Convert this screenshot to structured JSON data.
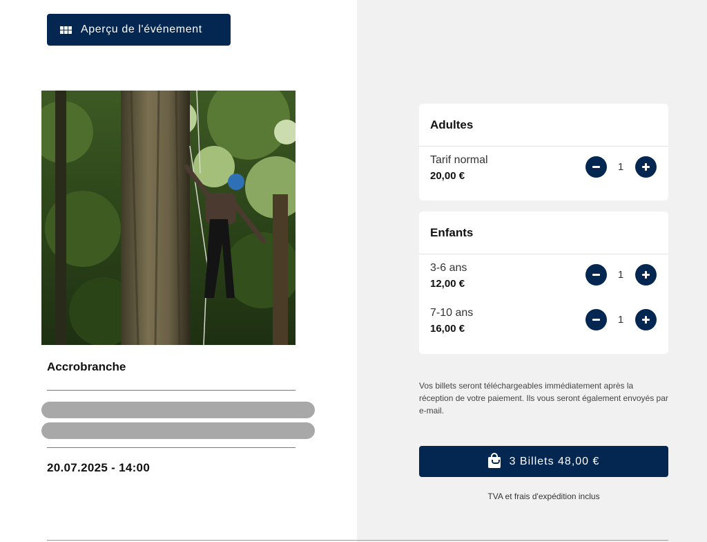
{
  "header": {
    "overview_label": "Aperçu de l'événement",
    "overview_icon": "grid-icon"
  },
  "event": {
    "title": "Accrobranche",
    "date": "20.07.2025 - 14:00"
  },
  "tickets": {
    "adults": {
      "heading": "Adultes",
      "rows": [
        {
          "label": "Tarif normal",
          "price": "20,00 €",
          "qty": "1"
        }
      ]
    },
    "kids": {
      "heading": "Enfants",
      "rows": [
        {
          "label": "3-6 ans",
          "price": "12,00 €",
          "qty": "1"
        },
        {
          "label": "7-10 ans",
          "price": "16,00 €",
          "qty": "1"
        }
      ]
    }
  },
  "info_text": "Vos billets seront téléchargeables immédiatement après la réception de votre paiement. Ils vous seront également envoyés par e-mail.",
  "checkout": {
    "button_label": "3 Billets 48,00 €",
    "button_icon": "shopping-bag-icon",
    "vat_note": "TVA et frais d'expédition inclus"
  },
  "colors": {
    "primary": "#042752",
    "panel_background": "#f1f1f1",
    "redacted": "#a8a8a8"
  }
}
